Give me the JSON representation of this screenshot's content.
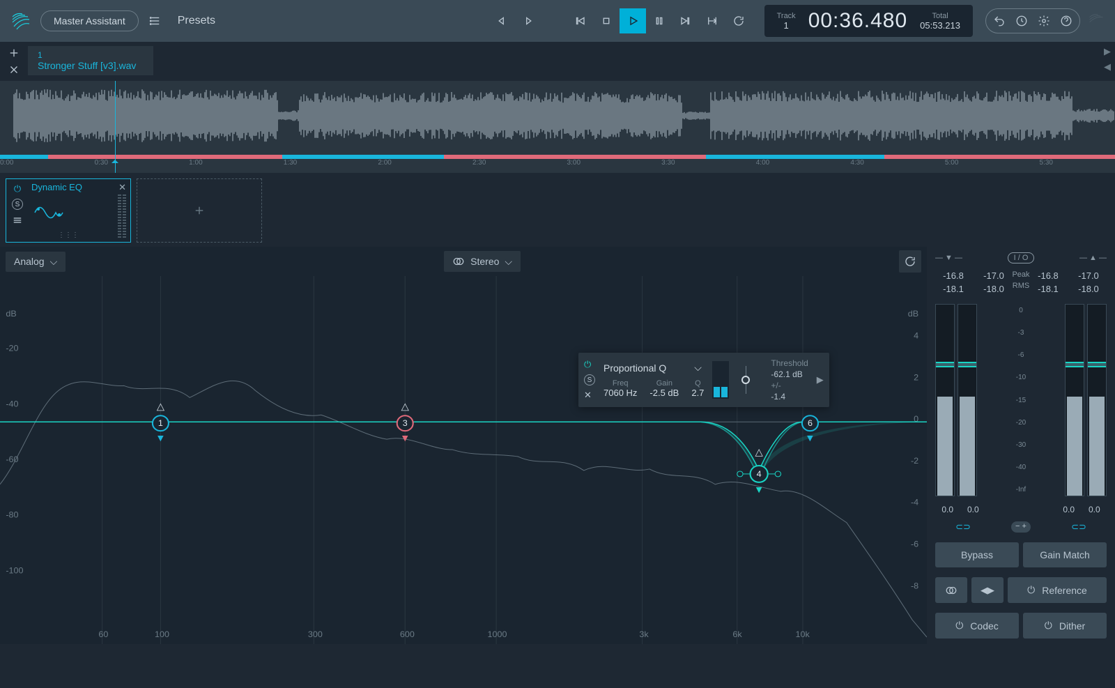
{
  "header": {
    "master_assistant": "Master Assistant",
    "presets": "Presets",
    "track_label": "Track",
    "track_num": "1",
    "time": "00:36.480",
    "total_label": "Total",
    "total_time": "05:53.213"
  },
  "tab": {
    "number": "1",
    "filename": "Stronger Stuff [v3].wav"
  },
  "timeline": {
    "marks": [
      "0:00",
      "0:30",
      "1:00",
      "1:30",
      "2:00",
      "2:30",
      "3:00",
      "3:30",
      "4:00",
      "4:30",
      "5:00",
      "5:30"
    ]
  },
  "module": {
    "name": "Dynamic EQ"
  },
  "eq": {
    "mode": "Analog",
    "channel": "Stereo",
    "db_left": "dB",
    "db_right": "dB",
    "y_left": [
      "-20",
      "-40",
      "-60",
      "-80",
      "-100"
    ],
    "y_right": [
      "4",
      "2",
      "0",
      "-2",
      "-4",
      "-6",
      "-8"
    ],
    "x_labels": [
      "60",
      "100",
      "300",
      "600",
      "1000",
      "3k",
      "6k",
      "10k"
    ]
  },
  "popup": {
    "type": "Proportional Q",
    "freq_hdr": "Freq",
    "gain_hdr": "Gain",
    "q_hdr": "Q",
    "freq": "7060 Hz",
    "gain": "-2.5 dB",
    "q": "2.7",
    "thresh_label": "Threshold",
    "thresh": "-62.1 dB",
    "plusminus": "+/-",
    "range": "-1.4"
  },
  "meters": {
    "io_label": "I / O",
    "peak": "Peak",
    "rms": "RMS",
    "in_peak_l": "-16.8",
    "in_peak_r": "-17.0",
    "in_rms_l": "-18.1",
    "in_rms_r": "-18.0",
    "out_peak_l": "-16.8",
    "out_peak_r": "-17.0",
    "out_rms_l": "-18.1",
    "out_rms_r": "-18.0",
    "scale": [
      "0",
      "-3",
      "-6",
      "-10",
      "-15",
      "-20",
      "-30",
      "-40",
      "-Inf"
    ],
    "btm": "0.0"
  },
  "buttons": {
    "bypass": "Bypass",
    "gain_match": "Gain Match",
    "reference": "Reference",
    "codec": "Codec",
    "dither": "Dither"
  }
}
